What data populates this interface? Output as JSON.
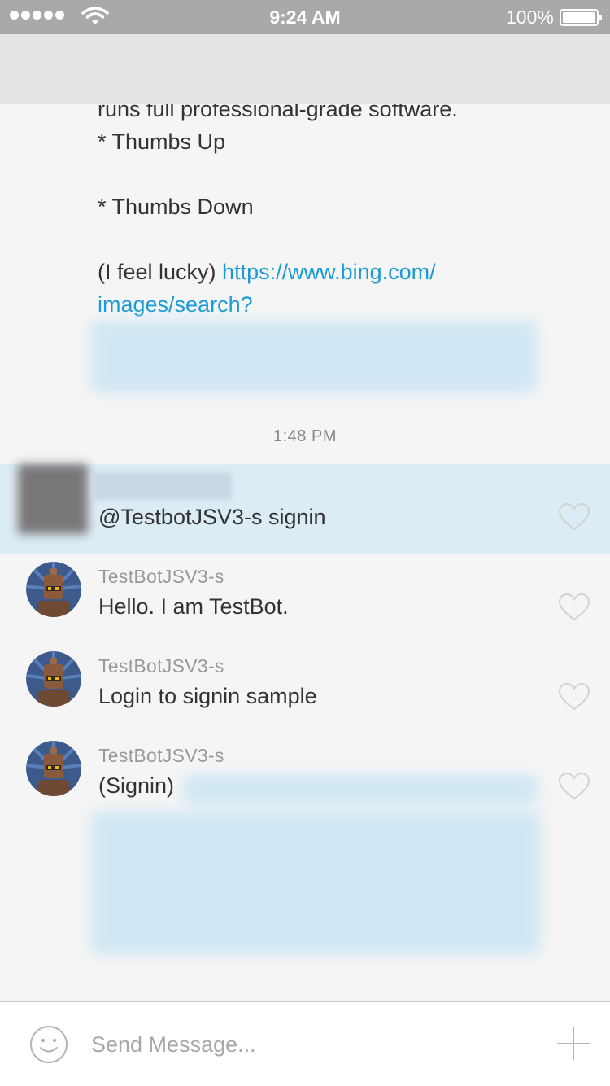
{
  "status_bar": {
    "time": "9:24 AM",
    "battery": "100%"
  },
  "previous_message": {
    "line1": "runs full professional-grade software.",
    "line2": "* Thumbs Up",
    "line3": "* Thumbs Down",
    "lucky_label": "(I feel lucky) ",
    "link_part1": "https://www.bing.com/",
    "link_part2": "images/search?"
  },
  "timestamp": "1:48 PM",
  "messages": [
    {
      "sender": "",
      "text": "@TestbotJSV3-s signin"
    },
    {
      "sender": "TestBotJSV3-s",
      "text": "Hello. I am TestBot."
    },
    {
      "sender": "TestBotJSV3-s",
      "text": "Login to signin sample"
    },
    {
      "sender": "TestBotJSV3-s",
      "text": "(Signin)"
    }
  ],
  "input": {
    "placeholder": "Send Message..."
  },
  "icons": {
    "signal": "signal-dots-icon",
    "wifi": "wifi-icon",
    "battery": "battery-icon",
    "like": "heart-icon",
    "emoji": "smiley-icon",
    "add": "plus-icon"
  },
  "colors": {
    "link": "#1a9bd7",
    "highlight": "#dcecf5",
    "status_bar": "#a9a9a9"
  }
}
